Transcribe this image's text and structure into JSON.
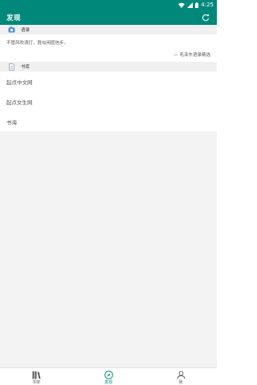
{
  "status_bar": {
    "time": "4:25",
    "icons": [
      "wifi-icon",
      "signal-icon",
      "battery-icon"
    ]
  },
  "app_bar": {
    "title": "发现",
    "action_icon": "refresh-icon"
  },
  "quote_section": {
    "header_icon": "camera-icon",
    "header": "语录",
    "quote": "不管风吹浪打，胜似闲庭信步。",
    "source": "— 毛泽东语录精选"
  },
  "library_section": {
    "header_icon": "document-icon",
    "header": "书库",
    "items": [
      {
        "label": "起点中文网"
      },
      {
        "label": "起点女生网"
      },
      {
        "label": "书海"
      }
    ]
  },
  "bottom_nav": {
    "items": [
      {
        "label": "书架",
        "icon": "bookshelf-icon",
        "active": false
      },
      {
        "label": "发现",
        "icon": "compass-icon",
        "active": true
      },
      {
        "label": "我",
        "icon": "person-icon",
        "active": false
      }
    ]
  },
  "colors": {
    "primary": "#00897b",
    "background": "#f3f3f3",
    "card": "#ffffff"
  }
}
